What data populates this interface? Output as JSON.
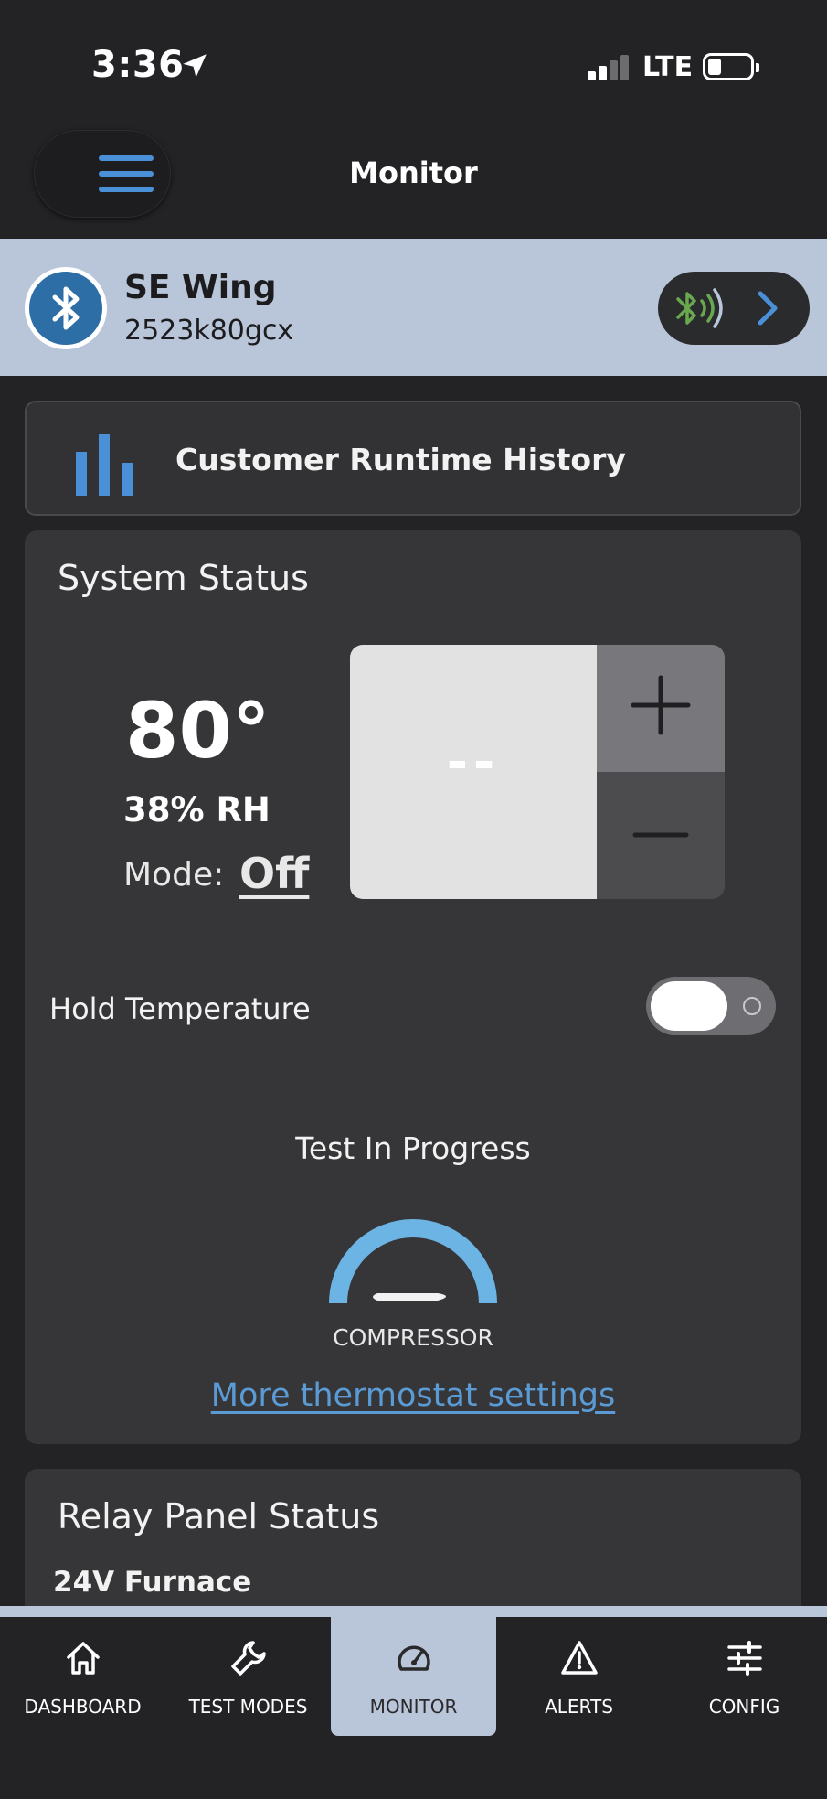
{
  "status_bar": {
    "time": "3:36",
    "network": "LTE",
    "location_icon": "location-arrow-icon",
    "battery_level_percent": 15
  },
  "header": {
    "title": "Monitor",
    "menu_icon": "hamburger-menu-icon"
  },
  "device": {
    "name": "SE Wing",
    "id": "2523k80gcx",
    "icon": "bluetooth-icon",
    "connection_icon": "bluetooth-signal-icon"
  },
  "runtime_history": {
    "label": "Customer Runtime History",
    "icon": "bar-chart-icon"
  },
  "system_status": {
    "title": "System Status",
    "temperature": "80°",
    "humidity": "38% RH",
    "mode_label": "Mode:",
    "mode_value": "Off",
    "setpoint": "--",
    "hold_label": "Hold Temperature",
    "hold_enabled": false,
    "progress_label": "Test In Progress",
    "gauge_label": "COMPRESSOR",
    "settings_link": "More thermostat settings"
  },
  "relay_panel": {
    "title": "Relay Panel Status",
    "first_item": "24V Furnace"
  },
  "tabs": [
    {
      "label": "DASHBOARD",
      "icon": "home-icon",
      "active": false
    },
    {
      "label": "TEST MODES",
      "icon": "wrench-icon",
      "active": false
    },
    {
      "label": "MONITOR",
      "icon": "speedometer-icon",
      "active": true
    },
    {
      "label": "ALERTS",
      "icon": "warning-icon",
      "active": false
    },
    {
      "label": "CONFIG",
      "icon": "sliders-icon",
      "active": false
    }
  ],
  "colors": {
    "background": "#232325",
    "card": "#363638",
    "accent_blue": "#4a90d9",
    "bar_highlight": "#b9c6d9",
    "gauge": "#6cb4e4",
    "bluetooth_green": "#6aa84f",
    "link": "#5b9bd5"
  }
}
